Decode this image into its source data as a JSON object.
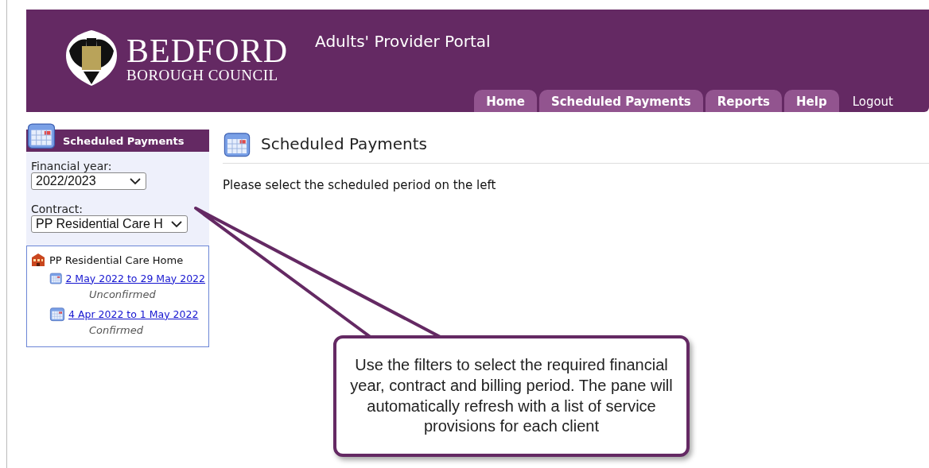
{
  "header": {
    "logo_line_1": "BEDFORD",
    "logo_line_2": "BOROUGH COUNCIL",
    "portal_title": "Adults' Provider Portal"
  },
  "nav": [
    {
      "label": "Home",
      "kind": "tab"
    },
    {
      "label": "Scheduled Payments",
      "kind": "tab"
    },
    {
      "label": "Reports",
      "kind": "tab"
    },
    {
      "label": "Help",
      "kind": "tab"
    },
    {
      "label": "Logout",
      "kind": "link"
    }
  ],
  "sidebar": {
    "title": "Scheduled Payments",
    "financial_year": {
      "label": "Financial year:",
      "value": "2022/2023"
    },
    "contract": {
      "label": "Contract:",
      "value": "PP Residential Care H"
    },
    "tree": {
      "label": "PP Residential Care Home",
      "children": [
        {
          "label": "2 May 2022 to 29 May 2022",
          "status": "Unconfirmed"
        },
        {
          "label": "4 Apr 2022 to 1 May 2022",
          "status": "Confirmed"
        }
      ]
    }
  },
  "main": {
    "title": "Scheduled Payments",
    "message": "Please select the scheduled period on the left"
  },
  "callout": {
    "text": "Use the filters to select the required financial year, contract and billing period. The pane will automatically refresh with a list of service provisions for each client"
  }
}
